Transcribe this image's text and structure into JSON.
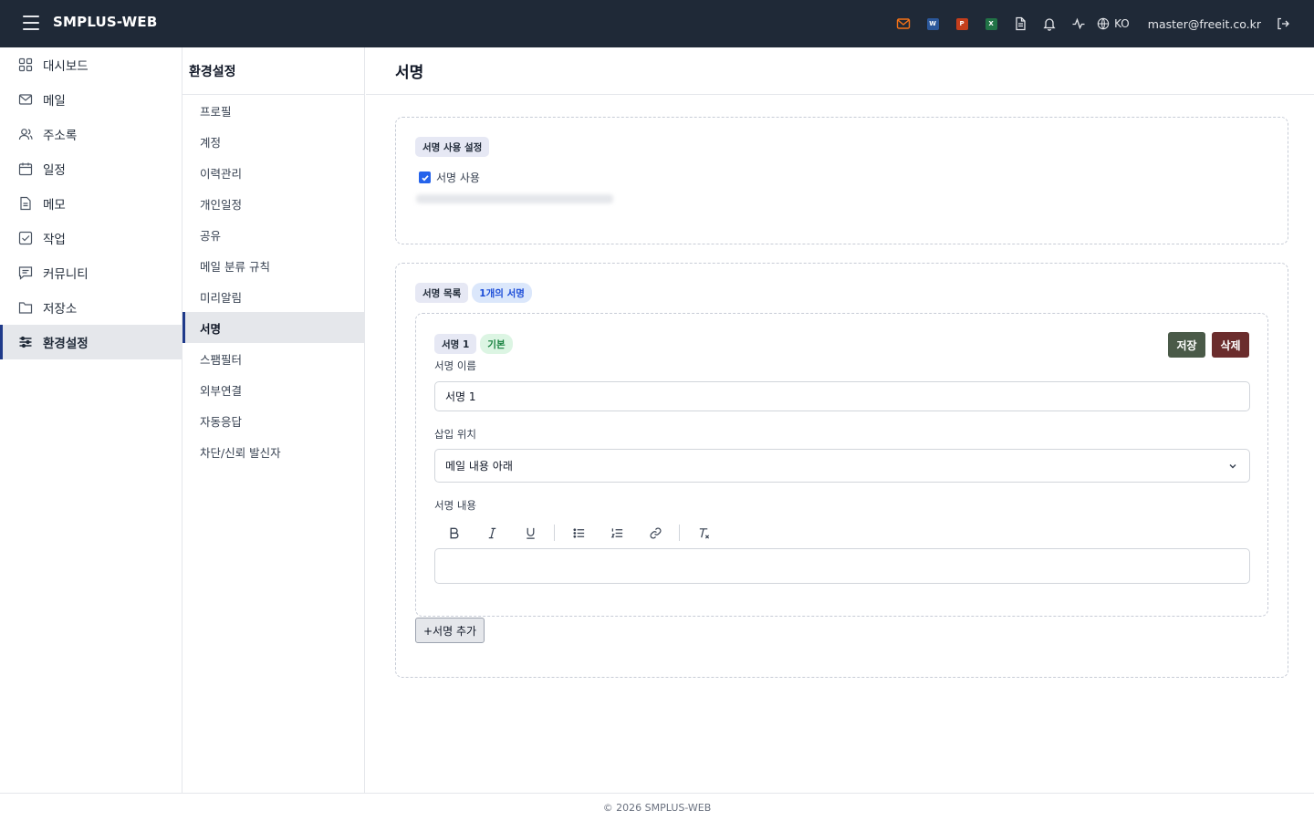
{
  "app": {
    "title": "SMPLUS-WEB"
  },
  "topbar": {
    "icons": [
      "mail-icon",
      "word-icon",
      "powerpoint-icon",
      "excel-icon",
      "document-icon",
      "bell-icon",
      "activity-icon",
      "globe-icon"
    ],
    "doc_badges": {
      "word": "W",
      "powerpoint": "P",
      "excel": "X"
    },
    "colors": {
      "background": "#1f2937",
      "mail": "#f97316",
      "word": "#2b579a",
      "powerpoint": "#c43e1c",
      "excel": "#217346"
    },
    "language": "KO",
    "user_email": "master@freeit.co.kr"
  },
  "sidebar": {
    "items": [
      {
        "label": "대시보드",
        "icon": "dashboard-icon"
      },
      {
        "label": "메일",
        "icon": "mail-icon"
      },
      {
        "label": "주소록",
        "icon": "contacts-icon"
      },
      {
        "label": "일정",
        "icon": "calendar-icon"
      },
      {
        "label": "메모",
        "icon": "memo-icon"
      },
      {
        "label": "작업",
        "icon": "task-icon"
      },
      {
        "label": "커뮤니티",
        "icon": "community-icon"
      },
      {
        "label": "저장소",
        "icon": "folder-icon"
      },
      {
        "label": "환경설정",
        "icon": "settings-sliders-icon",
        "active": true
      }
    ]
  },
  "submenu": {
    "title": "환경설정",
    "items": [
      {
        "label": "프로필"
      },
      {
        "label": "계정"
      },
      {
        "label": "이력관리"
      },
      {
        "label": "개인일정"
      },
      {
        "label": "공유"
      },
      {
        "label": "메일 분류 규칙"
      },
      {
        "label": "미리알림"
      },
      {
        "label": "서명",
        "active": true
      },
      {
        "label": "스팸필터"
      },
      {
        "label": "외부연결"
      },
      {
        "label": "자동응답"
      },
      {
        "label": "차단/신뢰 발신자"
      }
    ]
  },
  "main": {
    "title": "서명",
    "usage_section": {
      "badge": "서명 사용 설정",
      "checkbox_label": "서명 사용",
      "checked": true
    },
    "list_section": {
      "badge": "서명 목록",
      "count_badge": "1개의 서명",
      "signature": {
        "name_badge": "서명 1",
        "default_badge": "기본",
        "save_label": "저장",
        "delete_label": "삭제",
        "name_label": "서명 이름",
        "name_value": "서명 1",
        "position_label": "삽입 위치",
        "position_value": "메일 내용 아래",
        "content_label": "서명 내용",
        "toolbar": [
          "bold-icon",
          "italic-icon",
          "underline-icon",
          "bullet-list-icon",
          "numbered-list-icon",
          "link-icon",
          "clear-format-icon"
        ]
      },
      "add_label": "+서명 추가"
    }
  },
  "footer": {
    "text": "© 2026 SMPLUS-WEB"
  }
}
